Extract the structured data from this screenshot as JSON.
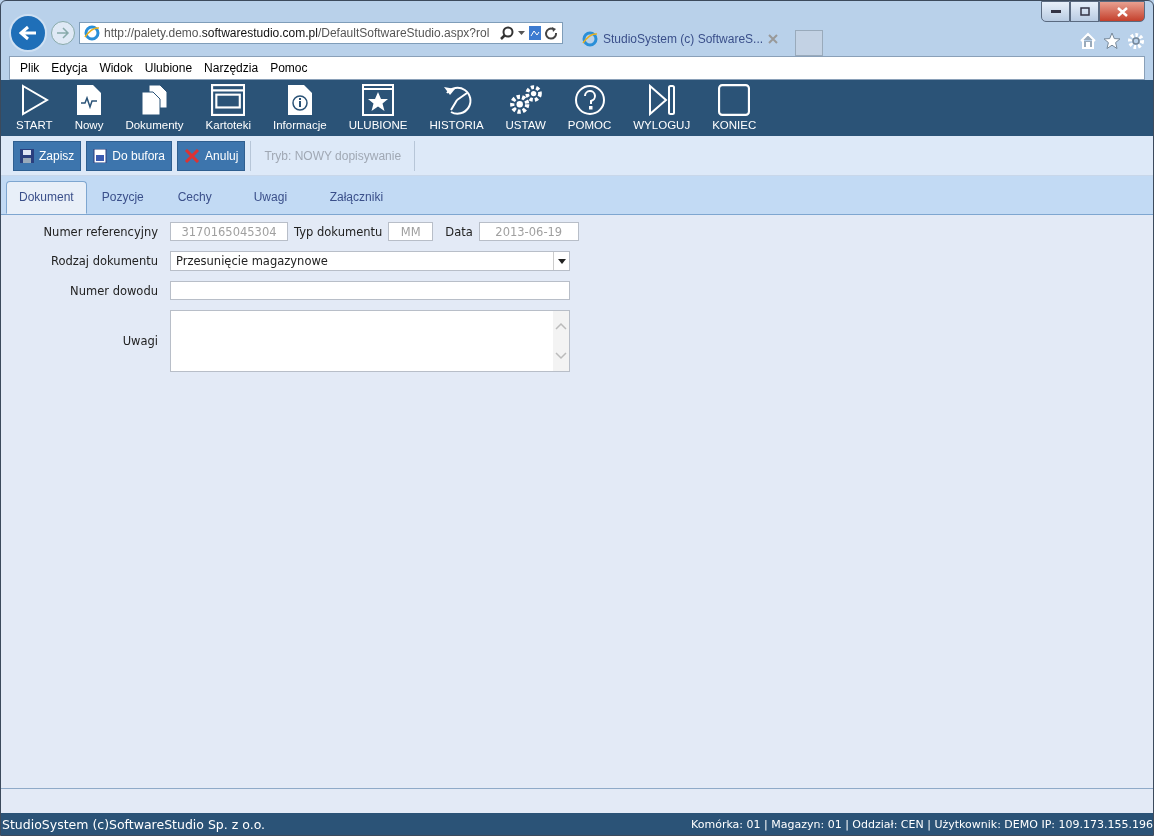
{
  "browser": {
    "address": "http://palety.demo.**softwarestudio.com.pl**/DefaultSoftwareStudio.aspx?rol",
    "tab_title": "StudioSystem (c) SoftwareS..."
  },
  "menu": [
    "Plik",
    "Edycja",
    "Widok",
    "Ulubione",
    "Narzędzia",
    "Pomoc"
  ],
  "toolbar": [
    {
      "label": "START",
      "kind": "play"
    },
    {
      "label": "Nowy",
      "kind": "new"
    },
    {
      "label": "Dokumenty",
      "kind": "docs"
    },
    {
      "label": "Kartoteki",
      "kind": "window"
    },
    {
      "label": "Informacje",
      "kind": "info"
    },
    {
      "label": "ULUBIONE",
      "kind": "star"
    },
    {
      "label": "HISTORIA",
      "kind": "history"
    },
    {
      "label": "USTAW",
      "kind": "gears"
    },
    {
      "label": "POMOC",
      "kind": "help"
    },
    {
      "label": "WYLOGUJ",
      "kind": "logout"
    },
    {
      "label": "KONIEC",
      "kind": "stop"
    }
  ],
  "actions": [
    {
      "label": "Zapisz",
      "kind": "save"
    },
    {
      "label": "Do bufora",
      "kind": "buffer"
    },
    {
      "label": "Anuluj",
      "kind": "cancel"
    }
  ],
  "mode": "Tryb: NOWY dopisywanie",
  "tabs": [
    {
      "label": "Dokument",
      "selected": true
    },
    {
      "label": "Pozycje",
      "selected": false
    },
    {
      "label": "Cechy",
      "selected": false
    },
    {
      "label": "Uwagi",
      "selected": false
    },
    {
      "label": "Załączniki",
      "selected": false
    }
  ],
  "form": {
    "reference": {
      "label": "Numer referencyjny",
      "value": "3170165045304",
      "disabled": true
    },
    "doc_type": {
      "label": "Typ dokumentu",
      "value": "MM",
      "disabled": true
    },
    "date": {
      "label": "Data",
      "value": "2013-06-19",
      "disabled": true
    },
    "doc_kind": {
      "label": "Rodzaj dokumentu",
      "value": "Przesunięcie magazynowe"
    },
    "proof_number": {
      "label": "Numer dowodu"
    },
    "notes": {
      "label": "Uwagi"
    }
  },
  "status_bar": {
    "left": "StudioSystem (c)SoftwareStudio Sp. z o.o.",
    "right": "Komórka: 01 | Magazyn: 01 | Oddział: CEN | Użytkownik: DEMO IP: 109.173.155.196"
  }
}
